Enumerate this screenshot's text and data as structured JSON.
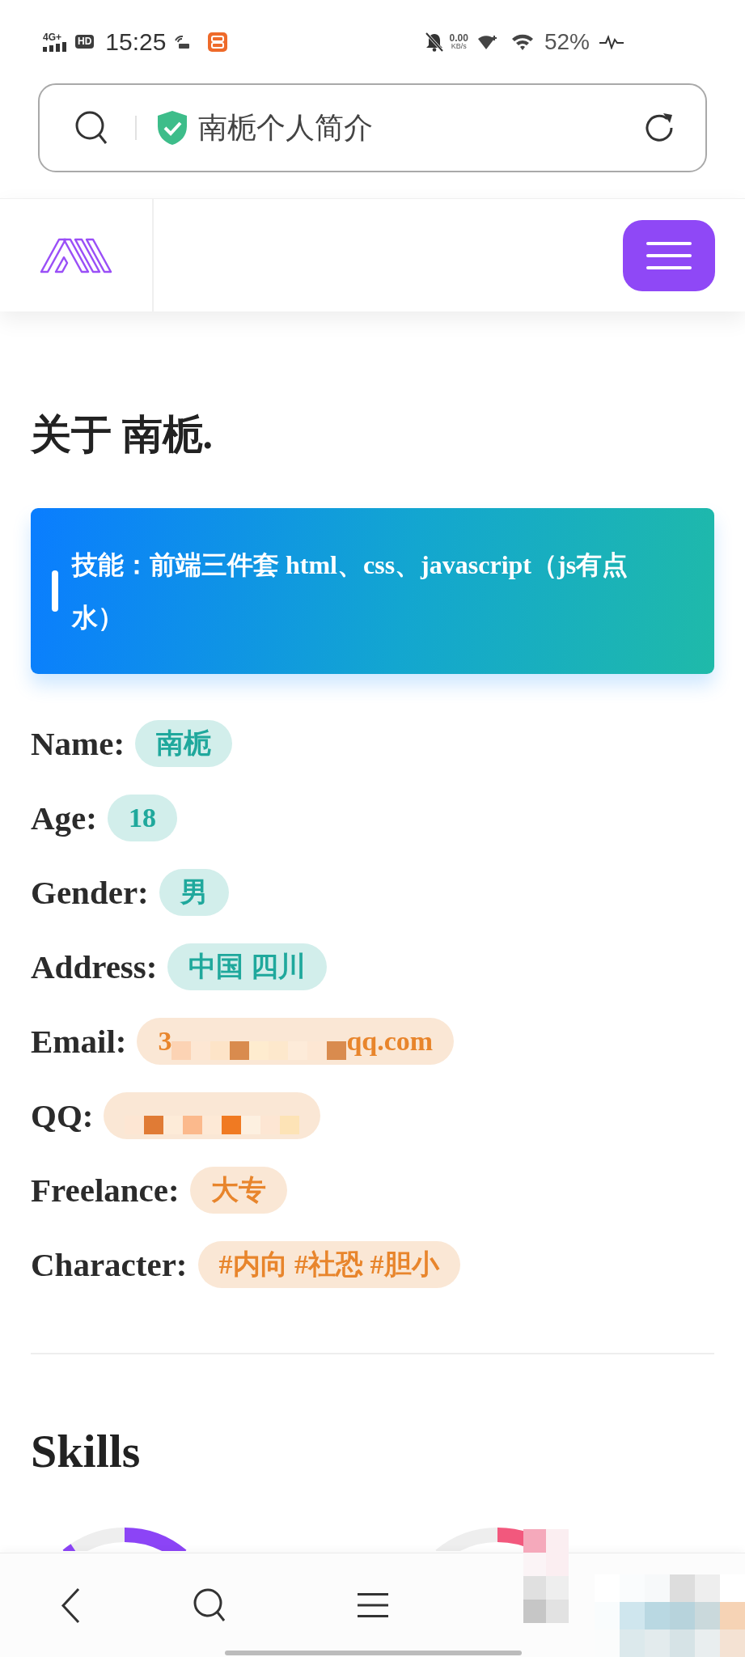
{
  "status_bar": {
    "network": "4G+",
    "hd": "HD",
    "time": "15:25",
    "speed_value": "0.00",
    "speed_unit": "KB/s",
    "battery": "52%"
  },
  "address_bar": {
    "title": "南栀个人简介",
    "secure": true
  },
  "about": {
    "title": "关于 南栀.",
    "banner": "技能：前端三件套 html、css、javascript（js有点水）",
    "fields": [
      {
        "label": "Name:",
        "value": "南栀",
        "color": "#1fa89c",
        "redacted": false
      },
      {
        "label": "Age:",
        "value": "18",
        "color": "#1fa89c",
        "redacted": false
      },
      {
        "label": "Gender:",
        "value": "男",
        "color": "#1fa89c",
        "redacted": false
      },
      {
        "label": "Address:",
        "value": "中国 四川",
        "color": "#1fa89c",
        "redacted": false
      },
      {
        "label": "Email:",
        "value": "3",
        "value_end": "qq.com",
        "color": "#e8852c",
        "redacted": true
      },
      {
        "label": "QQ:",
        "color": "#e8852c",
        "redacted": true
      },
      {
        "label": "Freelance:",
        "value": "大专",
        "color": "#e8852c",
        "redacted": false
      },
      {
        "label": "Character:",
        "value": "#内向 #社恐 #胆小",
        "color": "#e8852c",
        "redacted": false
      }
    ]
  },
  "skills": {
    "title": "Skills",
    "rings": [
      {
        "color": "#8c44f6"
      },
      {
        "color": "#f2587d"
      }
    ]
  },
  "bottom_bar": {
    "items": [
      {
        "kind": "back",
        "redacted": false
      },
      {
        "kind": "search",
        "redacted": false
      },
      {
        "kind": "menu",
        "redacted": false
      },
      {
        "kind": "tabs",
        "redacted": true
      }
    ],
    "corner_redacted": true
  }
}
